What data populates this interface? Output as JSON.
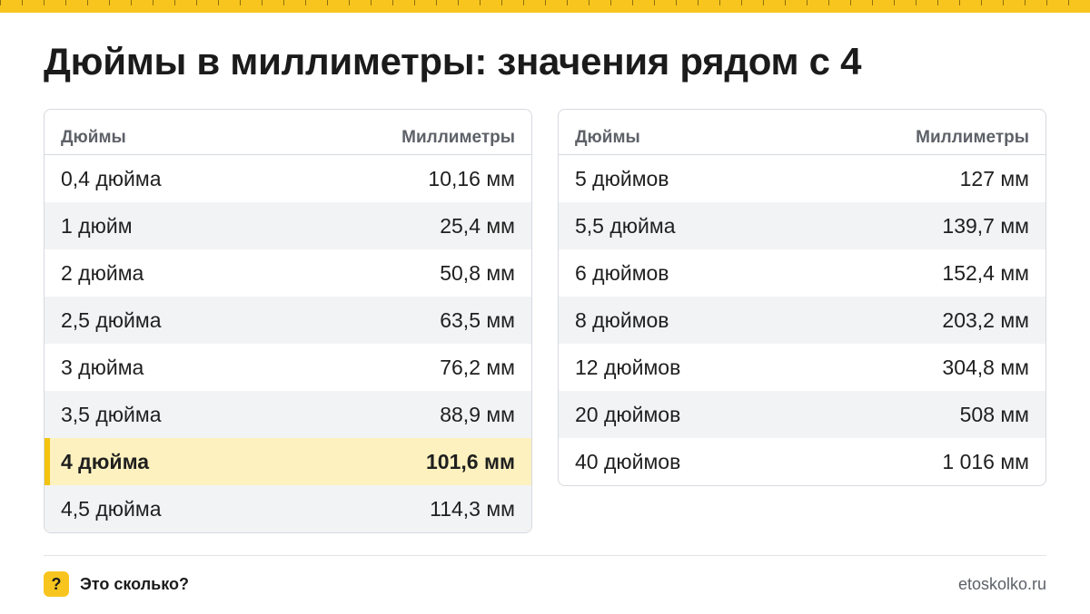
{
  "title": "Дюймы в миллиметры: значения рядом с 4",
  "colors": {
    "accent": "#f7c51e",
    "highlight_bg": "#fdf1bf",
    "highlight_bar": "#f2c30f"
  },
  "tables": [
    {
      "header": {
        "col1": "Дюймы",
        "col2": "Миллиметры"
      },
      "rows": [
        {
          "inches": "0,4 дюйма",
          "mm": "10,16 мм"
        },
        {
          "inches": "1 дюйм",
          "mm": "25,4 мм"
        },
        {
          "inches": "2 дюйма",
          "mm": "50,8 мм"
        },
        {
          "inches": "2,5 дюйма",
          "mm": "63,5 мм"
        },
        {
          "inches": "3 дюйма",
          "mm": "76,2 мм"
        },
        {
          "inches": "3,5 дюйма",
          "mm": "88,9 мм"
        },
        {
          "inches": "4 дюйма",
          "mm": "101,6 мм",
          "highlight": true
        },
        {
          "inches": "4,5 дюйма",
          "mm": "114,3 мм"
        }
      ]
    },
    {
      "header": {
        "col1": "Дюймы",
        "col2": "Миллиметры"
      },
      "rows": [
        {
          "inches": "5 дюймов",
          "mm": "127 мм"
        },
        {
          "inches": "5,5 дюйма",
          "mm": "139,7 мм"
        },
        {
          "inches": "6 дюймов",
          "mm": "152,4 мм"
        },
        {
          "inches": "8 дюймов",
          "mm": "203,2 мм"
        },
        {
          "inches": "12 дюймов",
          "mm": "304,8 мм"
        },
        {
          "inches": "20 дюймов",
          "mm": "508 мм"
        },
        {
          "inches": "40 дюймов",
          "mm": "1 016 мм"
        }
      ]
    }
  ],
  "footer": {
    "logo_glyph": "?",
    "logo_icon": "question-mark-icon",
    "brand": "Это сколько?",
    "site": "etoskolko.ru"
  }
}
